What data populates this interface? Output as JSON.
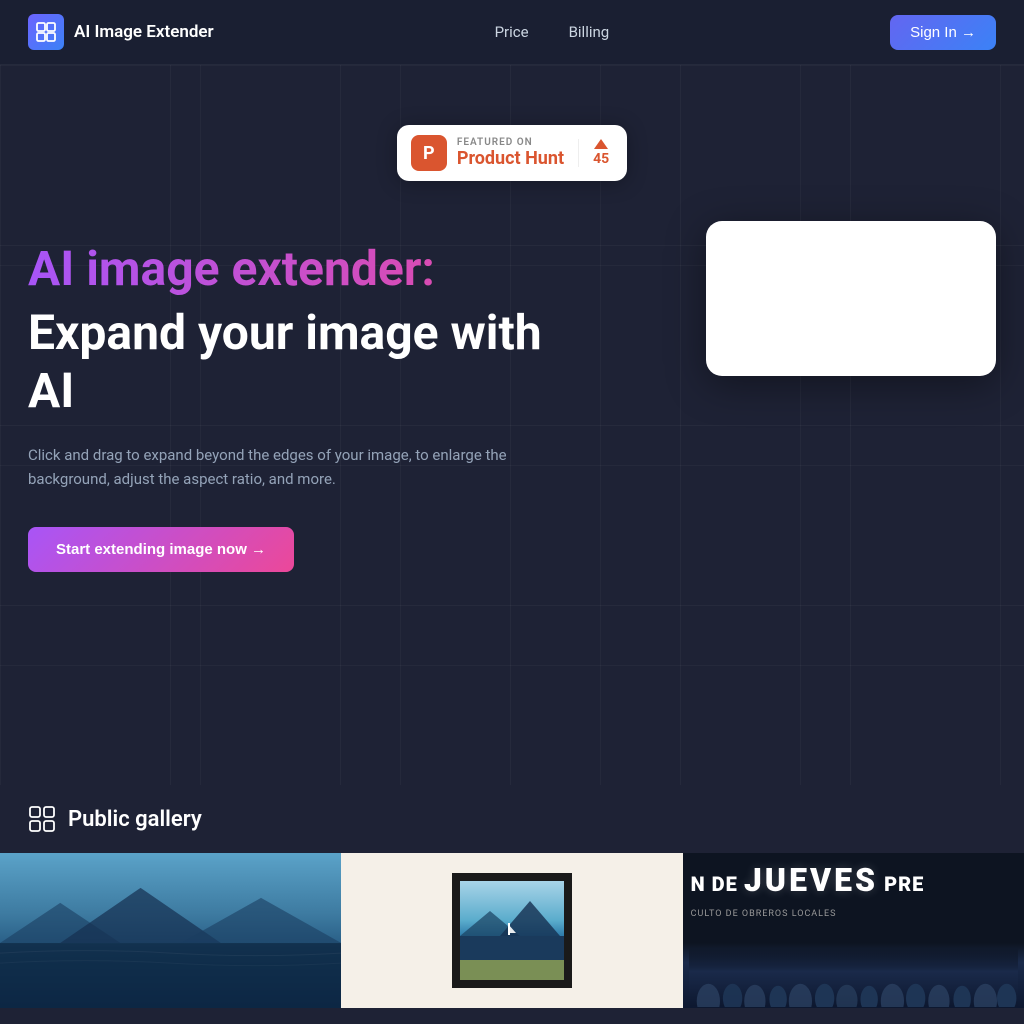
{
  "brand": {
    "name": "AI Image Extender"
  },
  "navbar": {
    "links": [
      {
        "id": "price",
        "label": "Price"
      },
      {
        "id": "billing",
        "label": "Billing"
      }
    ],
    "signin_label": "Sign In →"
  },
  "product_hunt": {
    "featured_label": "FEATURED ON",
    "name": "Product Hunt",
    "vote_count": "45"
  },
  "hero": {
    "title_gradient": "AI image extender:",
    "title_white_line1": "Expand your image with",
    "title_white_line2": "AI",
    "description": "Click and drag to expand beyond the edges of your image, to enlarge the background, adjust the aspect ratio, and more.",
    "cta_label": "Start extending image now →"
  },
  "gallery": {
    "title": "Public gallery",
    "icon": "gallery-icon"
  },
  "gallery_items": [
    {
      "id": "item-1",
      "type": "landscape-blue"
    },
    {
      "id": "item-2",
      "type": "framed-art"
    },
    {
      "id": "item-3",
      "type": "jueves-poster"
    }
  ],
  "jueves": {
    "prefix": "N DE",
    "main": "JUEVES",
    "suffix": "PRE",
    "sublabel": "CULTO DE OBREROS LOCALES"
  }
}
